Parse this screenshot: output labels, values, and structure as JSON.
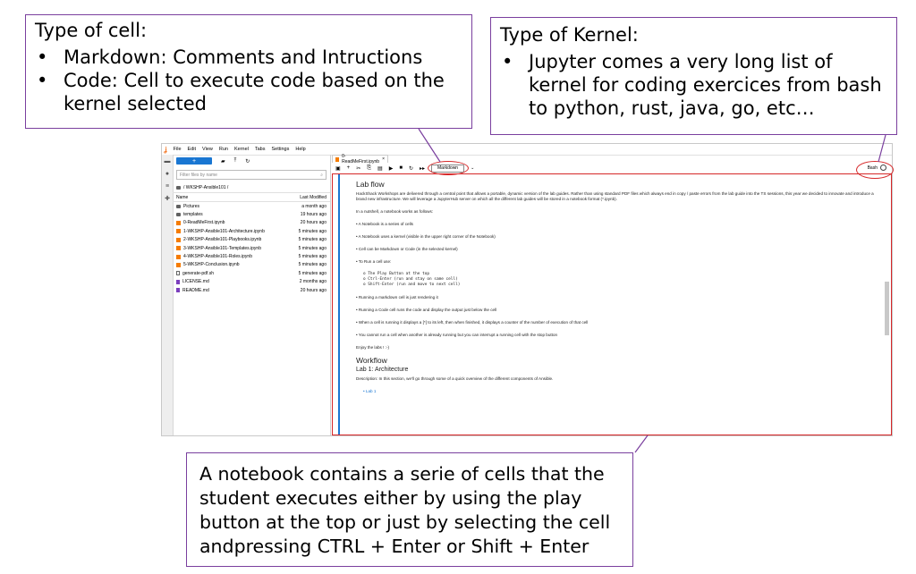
{
  "callouts": {
    "cell_type": {
      "title": "Type of cell:",
      "items": [
        "Markdown: Comments and Intructions",
        "Code: Cell to execute code based on the kernel selected"
      ]
    },
    "kernel_type": {
      "title": "Type of Kernel:",
      "items": [
        "Jupyter comes a very long list of kernel for coding exercices from bash to python, rust, java, go, etc…"
      ]
    },
    "notebook": {
      "text": "A notebook contains a serie of cells that the student executes  either by using the play button at the top or just by selecting the cell andpressing CTRL + Enter or Shift + Enter"
    }
  },
  "menubar": [
    "File",
    "Edit",
    "View",
    "Run",
    "Kernel",
    "Tabs",
    "Settings",
    "Help"
  ],
  "filebrowser": {
    "new_label": "+",
    "filter_placeholder": "Filter files by name",
    "breadcrumb": "/ WKSHP-Ansible101 /",
    "col_name": "Name",
    "col_modified": "Last Modified",
    "files": [
      {
        "name": "Pictures",
        "modified": "a month ago",
        "type": "folder"
      },
      {
        "name": "templates",
        "modified": "19 hours ago",
        "type": "folder"
      },
      {
        "name": "0-ReadMeFirst.ipynb",
        "modified": "20 hours ago",
        "type": "notebook"
      },
      {
        "name": "1-WKSHP-Ansible101-Architecture.ipynb",
        "modified": "5 minutes ago",
        "type": "notebook"
      },
      {
        "name": "2-WKSHP-Ansible101-Playbooks.ipynb",
        "modified": "5 minutes ago",
        "type": "notebook"
      },
      {
        "name": "3-WKSHP-Ansible101-Templates.ipynb",
        "modified": "5 minutes ago",
        "type": "notebook"
      },
      {
        "name": "4-WKSHP-Ansible101-Roles.ipynb",
        "modified": "5 minutes ago",
        "type": "notebook"
      },
      {
        "name": "5-WKSHP-Conclusion.ipynb",
        "modified": "5 minutes ago",
        "type": "notebook"
      },
      {
        "name": "generate-pdf.sh",
        "modified": "5 minutes ago",
        "type": "file"
      },
      {
        "name": "LICENSE.md",
        "modified": "2 months ago",
        "type": "md"
      },
      {
        "name": "README.md",
        "modified": "20 hours ago",
        "type": "md"
      }
    ]
  },
  "notebook": {
    "tab_name": "0-ReadMeFirst.ipynb",
    "cell_type": "Markdown",
    "kernel": "Bash",
    "content": {
      "h_lab_flow": "Lab flow",
      "p_intro": "HackShack Workshops are delivered through a central point that allows a portable, dynamic version of the lab guides. Rather than using standard PDF files which always end in copy / paste errors from the lab guide into the TS sessions, this year we decided to innovate and introduce a brand new infrastructure. We will leverage a JupyterHub server on which all the different lab guides will be stored in a notebook format (*.ipynb).",
      "p_nutshell": "In a nutshell, a notebook works as follows:",
      "b1": "• A Notebook is a series of cells",
      "b2": "• A Notebook uses a kernel (visible in the upper right corner of the Notebook)",
      "b3": "• Cell can be Markdown or Code (in the selected kernel)",
      "b4": "• To Run a cell use:",
      "code": "o The Play Button at the top\no Ctrl-Enter (run and stay on same cell)\no Shift-Enter (run and move to next cell)",
      "b5": "• Running a markdown cell is just rendering it",
      "b6": "• Running a Code cell runs the code and display the output just below the cell",
      "b7": "• When a cell is running it displays a [*] to its left, then when finished, it displays a counter of the number of execution of that cell",
      "b8": "• You cannot run a cell when another is already running but you can interrupt a running cell with the stop button",
      "enjoy": "Enjoy the labs ! :-)",
      "h_workflow": "Workflow",
      "h_lab1": "Lab 1: Architecture",
      "p_desc": "Description: In this section, we'll go through some of a quick overview of the different components of Ansible.",
      "link": "Lab 1"
    }
  },
  "colors": {
    "callout_border": "#7a3f9e",
    "highlight_red": "#d62728",
    "accent_blue": "#1976d2",
    "jupyter_orange": "#f37726"
  }
}
